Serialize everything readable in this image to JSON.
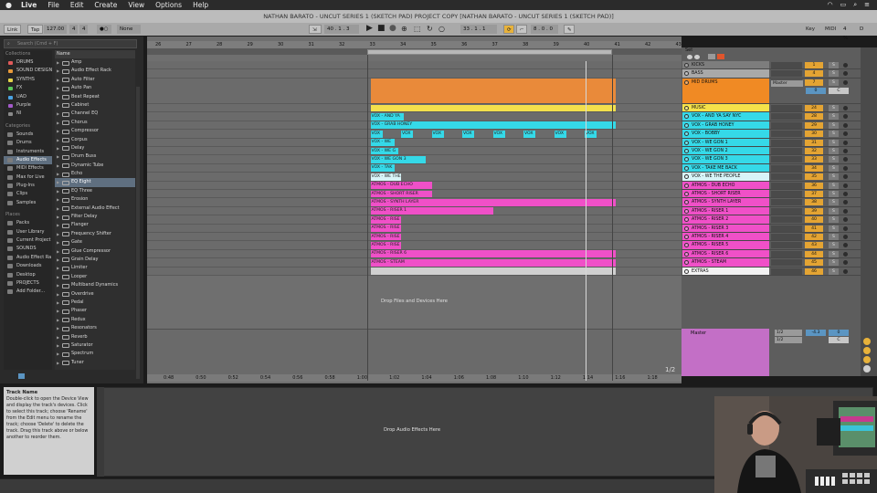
{
  "menubar": {
    "items": [
      "Live",
      "File",
      "Edit",
      "Create",
      "View",
      "Options",
      "Help"
    ]
  },
  "title": "NATHAN BARATO - UNCUT SERIES 1 (SKETCH PAD) PROJECT COPY  [NATHAN BARATO - UNCUT SERIES 1 (SKETCH PAD)]",
  "transport": {
    "link": "Link",
    "tap": "Tap",
    "tempo": "127.00",
    "signature_num": "4",
    "signature_den": "4",
    "metro": "1 Bar",
    "quant": "None",
    "position": "40 . 1 . 3",
    "loop_start": "33 . 1 . 1",
    "loop_len": "8 . 0 . 0",
    "key": "Key",
    "midi": "MIDI",
    "cpu": "4 %",
    "d": "D"
  },
  "browser": {
    "search_placeholder": "Search (Cmd + F)",
    "collections_label": "Collections",
    "collections": [
      {
        "label": "DRUMS",
        "color": "#e05a5a"
      },
      {
        "label": "SOUND DESIGN",
        "color": "#e89a3a"
      },
      {
        "label": "SYNTHS",
        "color": "#e3d34a"
      },
      {
        "label": "FX",
        "color": "#5ac85a"
      },
      {
        "label": "UAD",
        "color": "#4aa3e3"
      },
      {
        "label": "Purple",
        "color": "#a35ac8"
      },
      {
        "label": "NI",
        "color": "#8a8a8a"
      }
    ],
    "categories_label": "Categories",
    "categories": [
      "Sounds",
      "Drums",
      "Instruments",
      "Audio Effects",
      "MIDI Effects",
      "Max for Live",
      "Plug-Ins",
      "Clips",
      "Samples"
    ],
    "selected_category": "Audio Effects",
    "places_label": "Places",
    "places": [
      "Packs",
      "User Library",
      "Current Project",
      "SOUNDS",
      "Audio Effect Ra",
      "Downloads",
      "Desktop",
      "PROJECTS",
      "Add Folder..."
    ],
    "name_header": "Name",
    "items": [
      "Amp",
      "Audio Effect Rack",
      "Auto Filter",
      "Auto Pan",
      "Beat Repeat",
      "Cabinet",
      "Channel EQ",
      "Chorus",
      "Compressor",
      "Corpus",
      "Delay",
      "Drum Buss",
      "Dynamic Tube",
      "Echo",
      "EQ Eight",
      "EQ Three",
      "Erosion",
      "External Audio Effect",
      "Filter Delay",
      "Flanger",
      "Frequency Shifter",
      "Gate",
      "Glue Compressor",
      "Grain Delay",
      "Limiter",
      "Looper",
      "Multiband Dynamics",
      "Overdrive",
      "Pedal",
      "Phaser",
      "Redux",
      "Resonators",
      "Reverb",
      "Saturator",
      "Spectrum",
      "Tuner"
    ],
    "selected_item": "EQ Eight"
  },
  "info": {
    "title": "Track Name",
    "body": "Double-click to open the Device View and display the track's devices. Click to select this track; choose 'Rename' from the Edit menu to rename the track; choose 'Delete' to delete the track. Drag this track above or below another to reorder them."
  },
  "ruler": {
    "bars": [
      "26",
      "27",
      "28",
      "29",
      "30",
      "31",
      "32",
      "33",
      "34",
      "35",
      "36",
      "37",
      "38",
      "39",
      "40",
      "41",
      "42",
      "43"
    ]
  },
  "time_ruler": {
    "labels": [
      "0:48",
      "0:50",
      "0:52",
      "0:54",
      "0:56",
      "0:58",
      "1:00",
      "1:02",
      "1:04",
      "1:06",
      "1:08",
      "1:10",
      "1:12",
      "1:14",
      "1:16",
      "1:18"
    ]
  },
  "page_indicator": "1/2",
  "drop_files": "Drop Files and Devices Here",
  "drop_effects": "Drop Audio Effects Here",
  "set_label": "Set",
  "tracks": [
    {
      "name": "KICKS",
      "num": "1",
      "color": "#7d7d7d",
      "h": 1
    },
    {
      "name": "BASS",
      "num": "4",
      "color": "#a9a9a9",
      "h": 1
    },
    {
      "name": "MID DRUMS",
      "num": "7",
      "color": "#f08a24",
      "h": 3
    },
    {
      "name": "MUSIC",
      "num": "24",
      "color": "#f5e24a",
      "h": 1
    },
    {
      "name": "VOX - AND YA SAY NYC",
      "num": "28",
      "color": "#35d9e8",
      "h": 1
    },
    {
      "name": "VOX - GRAB HONEY",
      "num": "29",
      "color": "#35d9e8",
      "h": 1
    },
    {
      "name": "VOX - BOBBY",
      "num": "30",
      "color": "#35d9e8",
      "h": 1
    },
    {
      "name": "VOX - WE GON 1",
      "num": "31",
      "color": "#35d9e8",
      "h": 1
    },
    {
      "name": "VOX - WE GON 2",
      "num": "32",
      "color": "#35d9e8",
      "h": 1
    },
    {
      "name": "VOX - WE GON 3",
      "num": "33",
      "color": "#35d9e8",
      "h": 1
    },
    {
      "name": "VOX - TAKE ME BACK",
      "num": "34",
      "color": "#35d9e8",
      "h": 1
    },
    {
      "name": "VOX - WE THE PEOPLE",
      "num": "35",
      "color": "#d8f4f8",
      "h": 1
    },
    {
      "name": "ATMOS - DUB ECHO",
      "num": "36",
      "color": "#f050c8",
      "h": 1
    },
    {
      "name": "ATMOS - SHORT RISER",
      "num": "37",
      "color": "#f050c8",
      "h": 1
    },
    {
      "name": "ATMOS - SYNTH LAYER",
      "num": "38",
      "color": "#f050c8",
      "h": 1
    },
    {
      "name": "ATMOS - RISER 1",
      "num": "39",
      "color": "#f050c8",
      "h": 1
    },
    {
      "name": "ATMOS - RISER 2",
      "num": "40",
      "color": "#f050c8",
      "h": 1
    },
    {
      "name": "ATMOS - RISER 3",
      "num": "41",
      "color": "#f050c8",
      "h": 1
    },
    {
      "name": "ATMOS - RISER 4",
      "num": "42",
      "color": "#f050c8",
      "h": 1
    },
    {
      "name": "ATMOS - RISER 5",
      "num": "43",
      "color": "#f050c8",
      "h": 1
    },
    {
      "name": "ATMOS - RISER 6",
      "num": "44",
      "color": "#f050c8",
      "h": 1
    },
    {
      "name": "ATMOS - STEAM",
      "num": "45",
      "color": "#f050c8",
      "h": 1
    },
    {
      "name": "EXTRAS",
      "num": "46",
      "color": "#f2f2f2",
      "h": 1
    }
  ],
  "clips": [
    {
      "row": 2,
      "label": "",
      "start": 33,
      "end": 41,
      "color": "#e98a3a"
    },
    {
      "row": 3,
      "label": "",
      "start": 33,
      "end": 41,
      "color": "#f3e04c"
    },
    {
      "row": 4,
      "label": "VOX - AND YA",
      "start": 33,
      "end": 34.1,
      "color": "#35d9e8"
    },
    {
      "row": 5,
      "label": "VOX - GRAB HONEY",
      "start": 33,
      "end": 41,
      "color": "#35d9e8"
    },
    {
      "row": 6,
      "label": "VOX",
      "start": 33,
      "end": 33.4,
      "color": "#35d9e8"
    },
    {
      "row": 6,
      "label": "VOX",
      "start": 34,
      "end": 34.4,
      "color": "#35d9e8"
    },
    {
      "row": 6,
      "label": "VOX",
      "start": 35,
      "end": 35.4,
      "color": "#35d9e8"
    },
    {
      "row": 6,
      "label": "VOX",
      "start": 36,
      "end": 36.4,
      "color": "#35d9e8"
    },
    {
      "row": 6,
      "label": "VOX",
      "start": 37,
      "end": 37.4,
      "color": "#35d9e8"
    },
    {
      "row": 6,
      "label": "VOX",
      "start": 38,
      "end": 38.4,
      "color": "#35d9e8"
    },
    {
      "row": 6,
      "label": "VOX",
      "start": 39,
      "end": 39.4,
      "color": "#35d9e8"
    },
    {
      "row": 6,
      "label": "VOX",
      "start": 40,
      "end": 40.4,
      "color": "#35d9e8"
    },
    {
      "row": 7,
      "label": "VOX - WE",
      "start": 33,
      "end": 33.8,
      "color": "#35d9e8"
    },
    {
      "row": 8,
      "label": "VOX - WE G",
      "start": 33,
      "end": 33.9,
      "color": "#35d9e8"
    },
    {
      "row": 9,
      "label": "VOX - WE GON 3",
      "start": 33,
      "end": 34.8,
      "color": "#35d9e8"
    },
    {
      "row": 10,
      "label": "VOX - TAK",
      "start": 33,
      "end": 33.8,
      "color": "#35d9e8"
    },
    {
      "row": 11,
      "label": "VOX - WE THE",
      "start": 33,
      "end": 34.0,
      "color": "#d8f4f8"
    },
    {
      "row": 12,
      "label": "ATMOS - DUB ECHO",
      "start": 33,
      "end": 35.0,
      "color": "#f050c8"
    },
    {
      "row": 13,
      "label": "ATMOS - SHORT RISER",
      "start": 33,
      "end": 35.0,
      "color": "#f050c8"
    },
    {
      "row": 14,
      "label": "ATMOS - SYNTH LAYER",
      "start": 33,
      "end": 41,
      "color": "#f050c8"
    },
    {
      "row": 15,
      "label": "ATMOS - RISER 1",
      "start": 33,
      "end": 37.0,
      "color": "#f050c8"
    },
    {
      "row": 16,
      "label": "ATMOS - RISE",
      "start": 33,
      "end": 34.0,
      "color": "#f050c8"
    },
    {
      "row": 17,
      "label": "ATMOS - RISE",
      "start": 33,
      "end": 34.0,
      "color": "#f050c8"
    },
    {
      "row": 18,
      "label": "ATMOS - RISE",
      "start": 33,
      "end": 34.0,
      "color": "#f050c8"
    },
    {
      "row": 19,
      "label": "ATMOS - RISE",
      "start": 33,
      "end": 34.0,
      "color": "#f050c8"
    },
    {
      "row": 20,
      "label": "ATMOS - RISER 6",
      "start": 33,
      "end": 41,
      "color": "#f050c8"
    },
    {
      "row": 21,
      "label": "ATMOS - STEAM",
      "start": 33,
      "end": 41,
      "color": "#f050c8"
    },
    {
      "row": 22,
      "label": "",
      "start": 33,
      "end": 41,
      "color": "#d0d0d0"
    }
  ],
  "mid_drums": {
    "output": "Master",
    "volume": "0",
    "pan": "C"
  },
  "master": {
    "name": "Master",
    "sel1": "1/2",
    "sel2": "1/2",
    "volume": "-4.3",
    "pan": "0",
    "pan_c": "C"
  }
}
